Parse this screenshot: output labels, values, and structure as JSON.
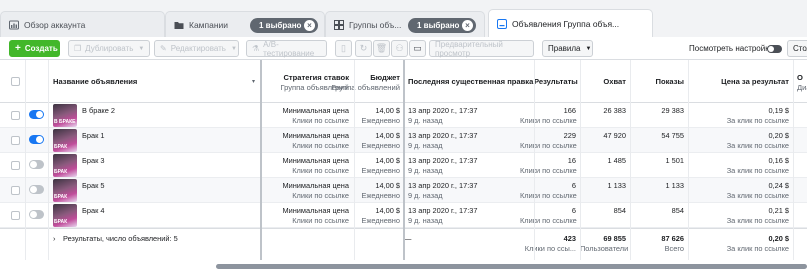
{
  "tabs": [
    {
      "label": "Обзор аккаунта"
    },
    {
      "label": "Кампании",
      "badge": "1 выбрано"
    },
    {
      "label": "Группы объ...",
      "badge": "1 выбрано"
    },
    {
      "label": "Объявления Группа объя..."
    }
  ],
  "toolbar": {
    "create": "Создать",
    "duplicate": "Дублировать",
    "edit": "Редактировать",
    "ab_test": "A/B-тестирование",
    "preview": "Предварительный просмотр",
    "rules": "Правила",
    "view_settings": "Посмотреть настройки",
    "columns": "Стол"
  },
  "columns": {
    "name": "Название объявления",
    "bid_strategy": "Стратегия ставок",
    "bid_strategy_sub": "Группа объявлений",
    "budget": "Бюджет",
    "budget_sub": "Группа объявлений",
    "last_edit": "Последняя существенная правка",
    "results": "Результаты",
    "reach": "Охват",
    "impressions": "Показы",
    "cost_per_result": "Цена за результат",
    "next": "О",
    "next_sub": "Диа"
  },
  "rows": [
    {
      "name": "В браке 2",
      "thumb": "В БРАКЕ",
      "active": true,
      "strategy": "Минимальная цена",
      "strategy_sub": "Клики по ссылке",
      "budget": "14,00 $",
      "budget_sub": "Ежедневно",
      "edited": "13 апр 2020 г., 17:37",
      "edited_sub": "9 д. назад",
      "results": "166",
      "results_sub": "Клики по ссылке",
      "reach": "26 383",
      "impressions": "29 383",
      "cost": "0,19 $",
      "cost_sub": "За клик по ссылке"
    },
    {
      "name": "Брак 1",
      "thumb": "БРАК",
      "active": true,
      "strategy": "Минимальная цена",
      "strategy_sub": "Клики по ссылке",
      "budget": "14,00 $",
      "budget_sub": "Ежедневно",
      "edited": "13 апр 2020 г., 17:37",
      "edited_sub": "9 д. назад",
      "results": "229",
      "results_sub": "Клики по ссылке",
      "reach": "47 920",
      "impressions": "54 755",
      "cost": "0,20 $",
      "cost_sub": "За клик по ссылке"
    },
    {
      "name": "Брак 3",
      "thumb": "БРАК",
      "active": false,
      "strategy": "Минимальная цена",
      "strategy_sub": "Клики по ссылке",
      "budget": "14,00 $",
      "budget_sub": "Ежедневно",
      "edited": "13 апр 2020 г., 17:37",
      "edited_sub": "9 д. назад",
      "results": "16",
      "results_sub": "Клики по ссылке",
      "reach": "1 485",
      "impressions": "1 501",
      "cost": "0,16 $",
      "cost_sub": "За клик по ссылке"
    },
    {
      "name": "Брак 5",
      "thumb": "БРАК",
      "active": false,
      "strategy": "Минимальная цена",
      "strategy_sub": "Клики по ссылке",
      "budget": "14,00 $",
      "budget_sub": "Ежедневно",
      "edited": "13 апр 2020 г., 17:37",
      "edited_sub": "9 д. назад",
      "results": "6",
      "results_sub": "Клики по ссылке",
      "reach": "1 133",
      "impressions": "1 133",
      "cost": "0,24 $",
      "cost_sub": "За клик по ссылке"
    },
    {
      "name": "Брак 4",
      "thumb": "БРАК",
      "active": false,
      "strategy": "Минимальная цена",
      "strategy_sub": "Клики по ссылке",
      "budget": "14,00 $",
      "budget_sub": "Ежедневно",
      "edited": "13 апр 2020 г., 17:37",
      "edited_sub": "9 д. назад",
      "results": "6",
      "results_sub": "Клики по ссылке",
      "reach": "854",
      "impressions": "854",
      "cost": "0,21 $",
      "cost_sub": "За клик по ссылке"
    }
  ],
  "summary": {
    "label": "Результаты, число объявлений: 5",
    "edited": "—",
    "results": "423",
    "results_sub": "Клики по ссы...",
    "reach": "69 855",
    "reach_sub": "Пользователи",
    "impressions": "87 626",
    "impressions_sub": "Всего",
    "cost": "0,20 $",
    "cost_sub": "За клик по ссылке"
  },
  "colors": {
    "accent": "#1877f2",
    "create": "#42b72a",
    "badge": "#606770"
  }
}
